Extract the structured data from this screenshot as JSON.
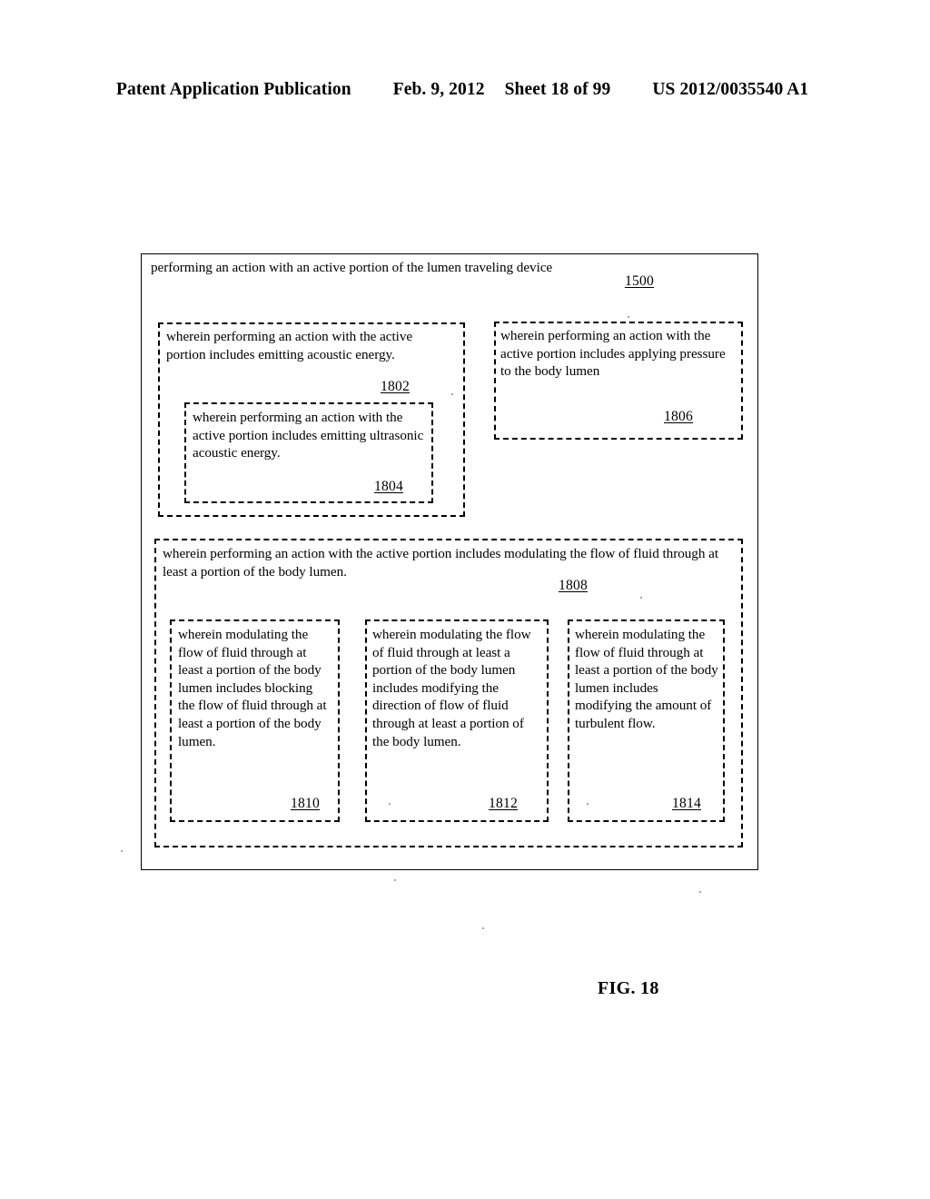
{
  "header": {
    "publication": "Patent Application Publication",
    "date": "Feb. 9, 2012",
    "sheet": "Sheet 18 of 99",
    "document_number": "US 2012/0035540 A1"
  },
  "figure": {
    "caption": "FIG. 18",
    "boxes": {
      "b1500": {
        "text": "performing an action with an active portion of the lumen traveling device",
        "ref": "1500"
      },
      "b1802": {
        "text": "wherein performing an action with the active portion includes emitting acoustic energy.",
        "ref": "1802"
      },
      "b1804": {
        "text": "wherein performing an action with the active portion includes emitting ultrasonic acoustic energy.",
        "ref": "1804"
      },
      "b1806": {
        "text": "wherein performing an action with the active portion includes applying pressure to the body lumen",
        "ref": "1806"
      },
      "b1808": {
        "text": "wherein performing an action with the active portion includes modulating the flow of fluid through at least a portion of the body lumen.",
        "ref": "1808"
      },
      "b1810": {
        "text": "wherein modulating the flow of fluid through at least a portion of the body lumen includes blocking the flow of fluid through at least a portion of the body lumen.",
        "ref": "1810"
      },
      "b1812": {
        "text": "wherein modulating the flow of fluid through at least a portion of the body lumen includes modifying the direction of flow of fluid through at least a portion of the body lumen.",
        "ref": "1812"
      },
      "b1814": {
        "text": "wherein modulating the flow of fluid through at least a portion of the body lumen includes modifying the amount of turbulent flow.",
        "ref": "1814"
      }
    }
  }
}
